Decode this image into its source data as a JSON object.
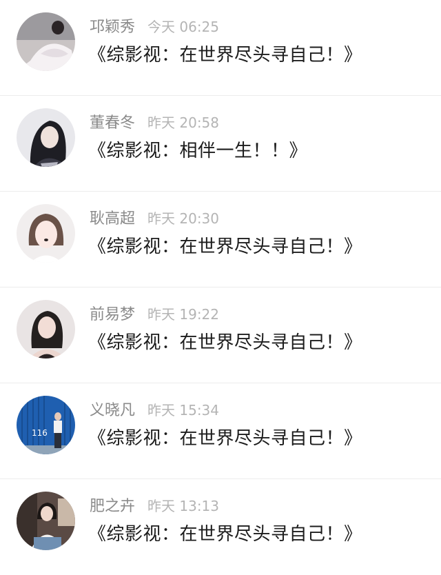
{
  "comments": [
    {
      "name": "邛颖秀",
      "time": "今天 06:25",
      "text": "《综影视：在世界尽头寻自己！》",
      "avatar": "avatar-girl-white-dress"
    },
    {
      "name": "董春冬",
      "time": "昨天 20:58",
      "text": "《综影视：相伴一生！！》",
      "avatar": "avatar-girl-long-hair"
    },
    {
      "name": "耿高超",
      "time": "昨天 20:30",
      "text": "《综影视：在世界尽头寻自己！》",
      "avatar": "avatar-girl-selfie"
    },
    {
      "name": "前易梦",
      "time": "昨天 19:22",
      "text": "《综影视：在世界尽头寻自己！》",
      "avatar": "avatar-girl-dark"
    },
    {
      "name": "义晓凡",
      "time": "昨天 15:34",
      "text": "《综影视：在世界尽头寻自己！》",
      "avatar": "avatar-blue-container",
      "avatar_text": "116"
    },
    {
      "name": "肥之卉",
      "time": "昨天 13:13",
      "text": "《综影视：在世界尽头寻自己！》",
      "avatar": "avatar-girl-sitting"
    }
  ]
}
